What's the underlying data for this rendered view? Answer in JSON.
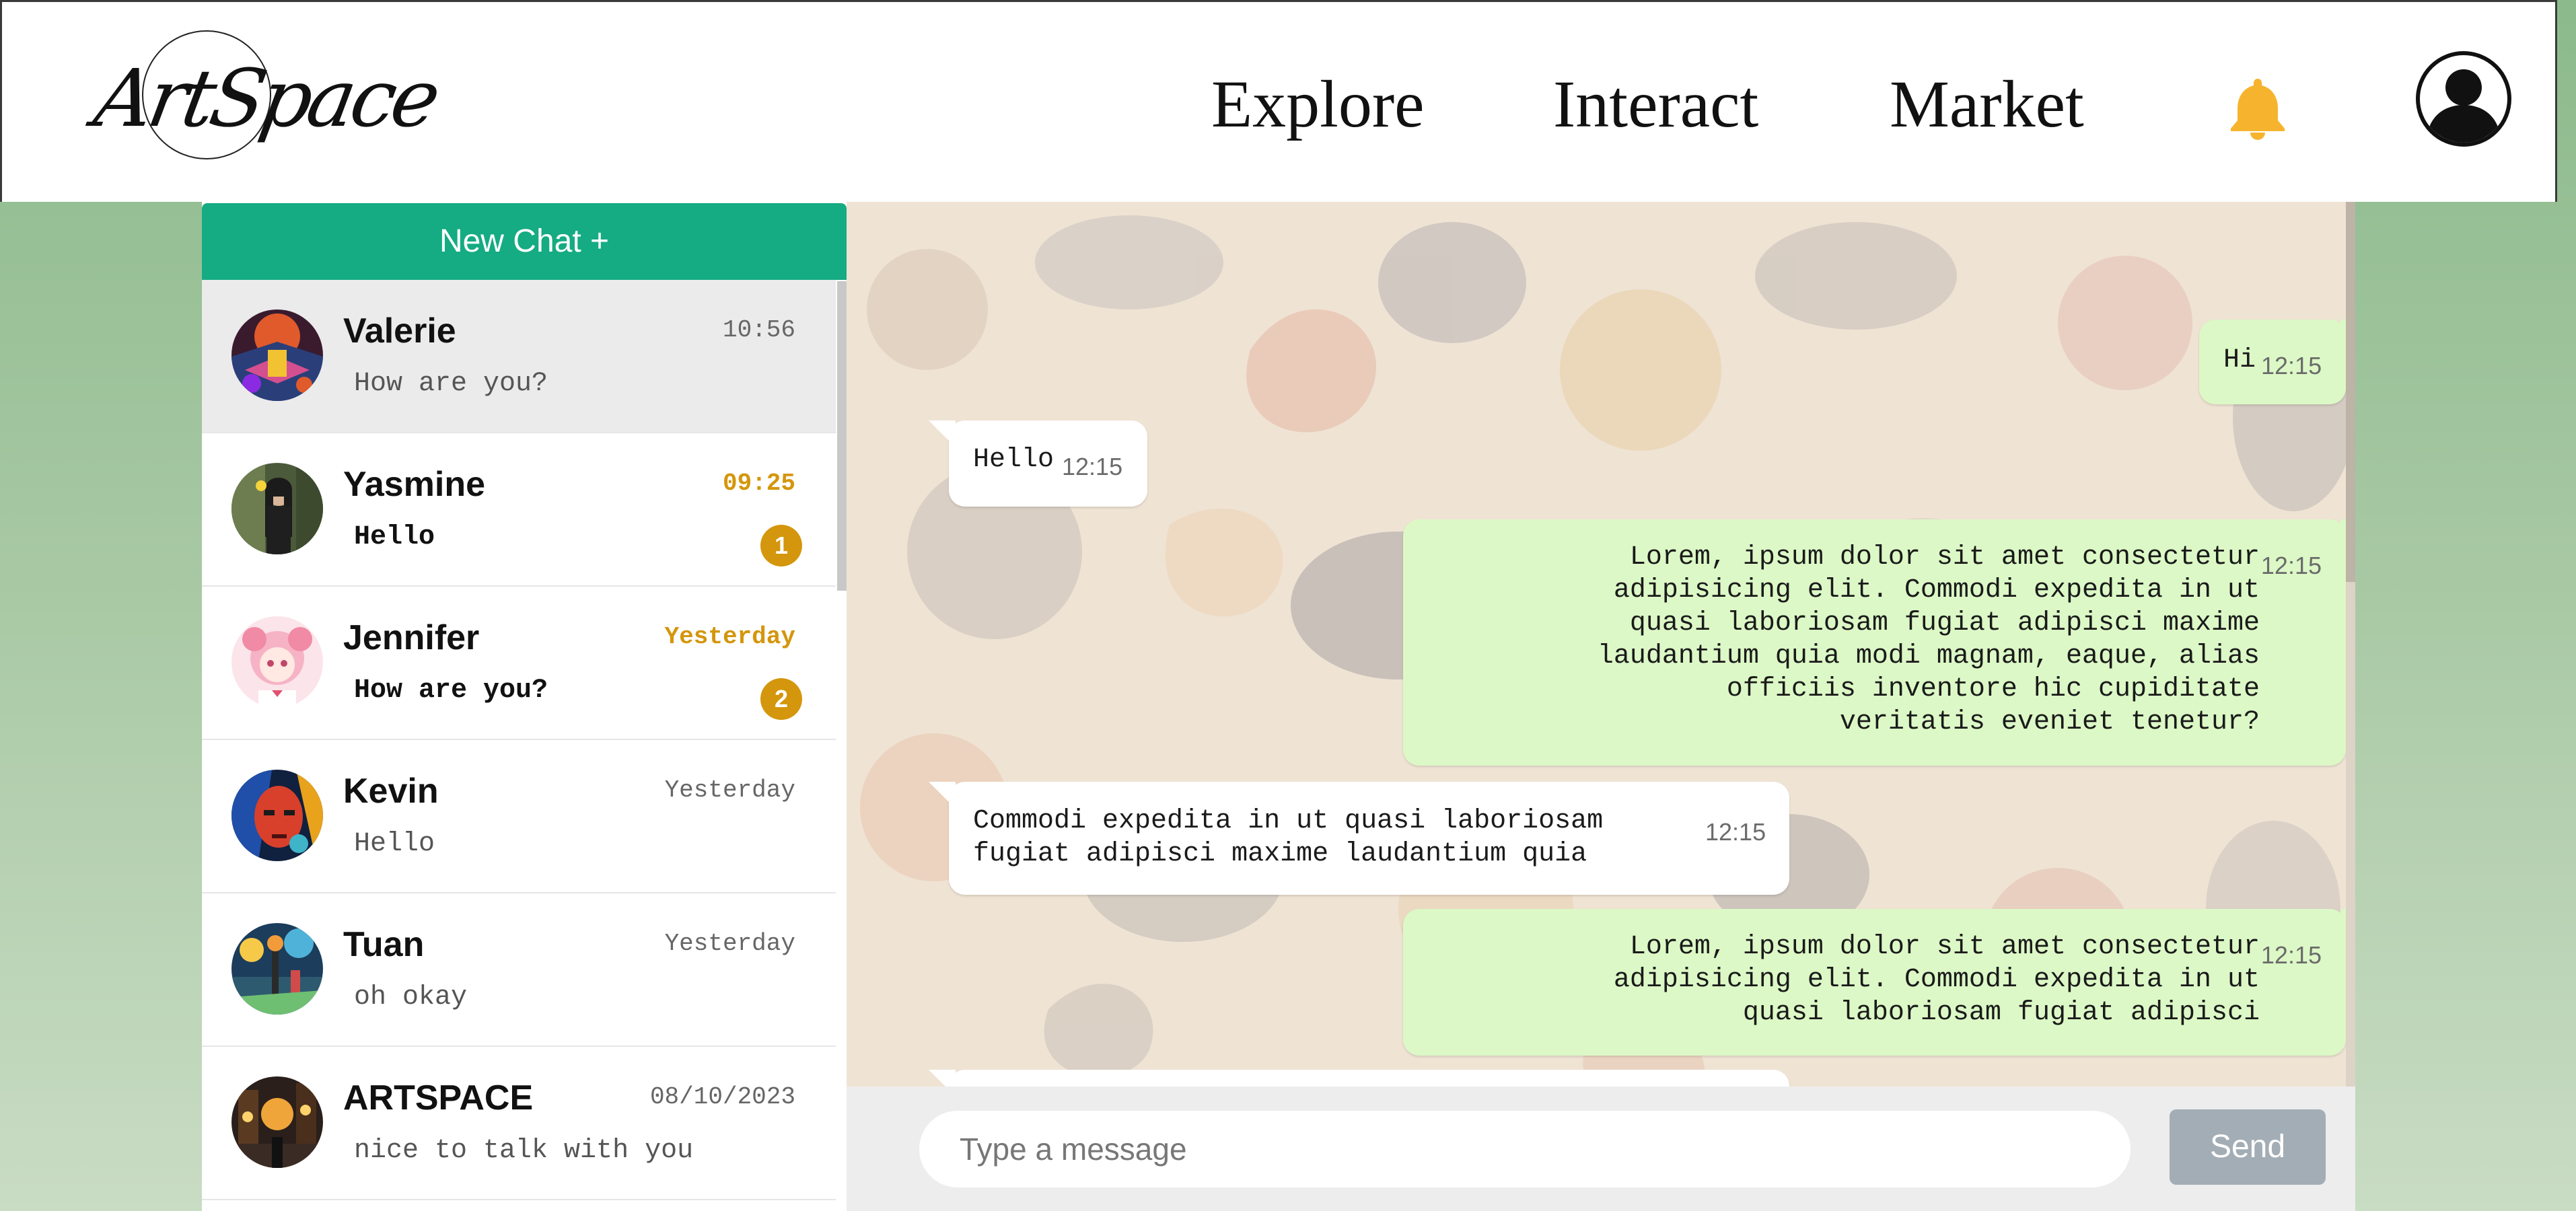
{
  "app": {
    "logo_text": "ArtSpace",
    "nav": [
      "Explore",
      "Interact",
      "Market"
    ],
    "icons": {
      "notifications": "bell-icon",
      "profile": "user-avatar-icon"
    },
    "colors": {
      "accent": "#15ab83",
      "unread": "#d4960c",
      "bell": "#f6b42e",
      "outgoing_bubble": "#dcf8c6"
    }
  },
  "sidebar": {
    "new_chat_label": "New Chat +",
    "chats": [
      {
        "name": "Valerie",
        "time": "10:56",
        "preview": "How are you?",
        "unread": "",
        "active": true
      },
      {
        "name": "Yasmine",
        "time": "09:25",
        "preview": "Hello",
        "unread": "1"
      },
      {
        "name": "Jennifer",
        "time": "Yesterday",
        "preview": "How are you?",
        "unread": "2"
      },
      {
        "name": "Kevin",
        "time": "Yesterday",
        "preview": "Hello",
        "unread": ""
      },
      {
        "name": "Tuan",
        "time": "Yesterday",
        "preview": "oh okay",
        "unread": ""
      },
      {
        "name": "ARTSPACE",
        "time": "08/10/2023",
        "preview": "nice to talk with you",
        "unread": ""
      }
    ]
  },
  "conversation": {
    "messages": [
      {
        "direction": "out",
        "text": "Hi",
        "time": "12:15"
      },
      {
        "direction": "in",
        "text": "Hello",
        "time": "12:15"
      },
      {
        "direction": "out",
        "text": "Lorem, ipsum dolor sit amet consectetur\nadipisicing elit. Commodi expedita in ut\nquasi laboriosam fugiat adipisci maxime\nlaudantium quia modi magnam, eaque, alias\nofficiis inventore hic cupiditate\nveritatis eveniet tenetur?",
        "time": "12:15"
      },
      {
        "direction": "in",
        "text": "Commodi expedita in ut quasi laboriosam\nfugiat adipisci maxime laudantium quia",
        "time": "12:15"
      },
      {
        "direction": "out",
        "text": "Lorem, ipsum dolor sit amet consectetur\nadipisicing elit. Commodi expedita in ut\nquasi laboriosam fugiat adipisci",
        "time": "12:15"
      }
    ]
  },
  "composer": {
    "placeholder": "Type a message",
    "send_label": "Send"
  }
}
